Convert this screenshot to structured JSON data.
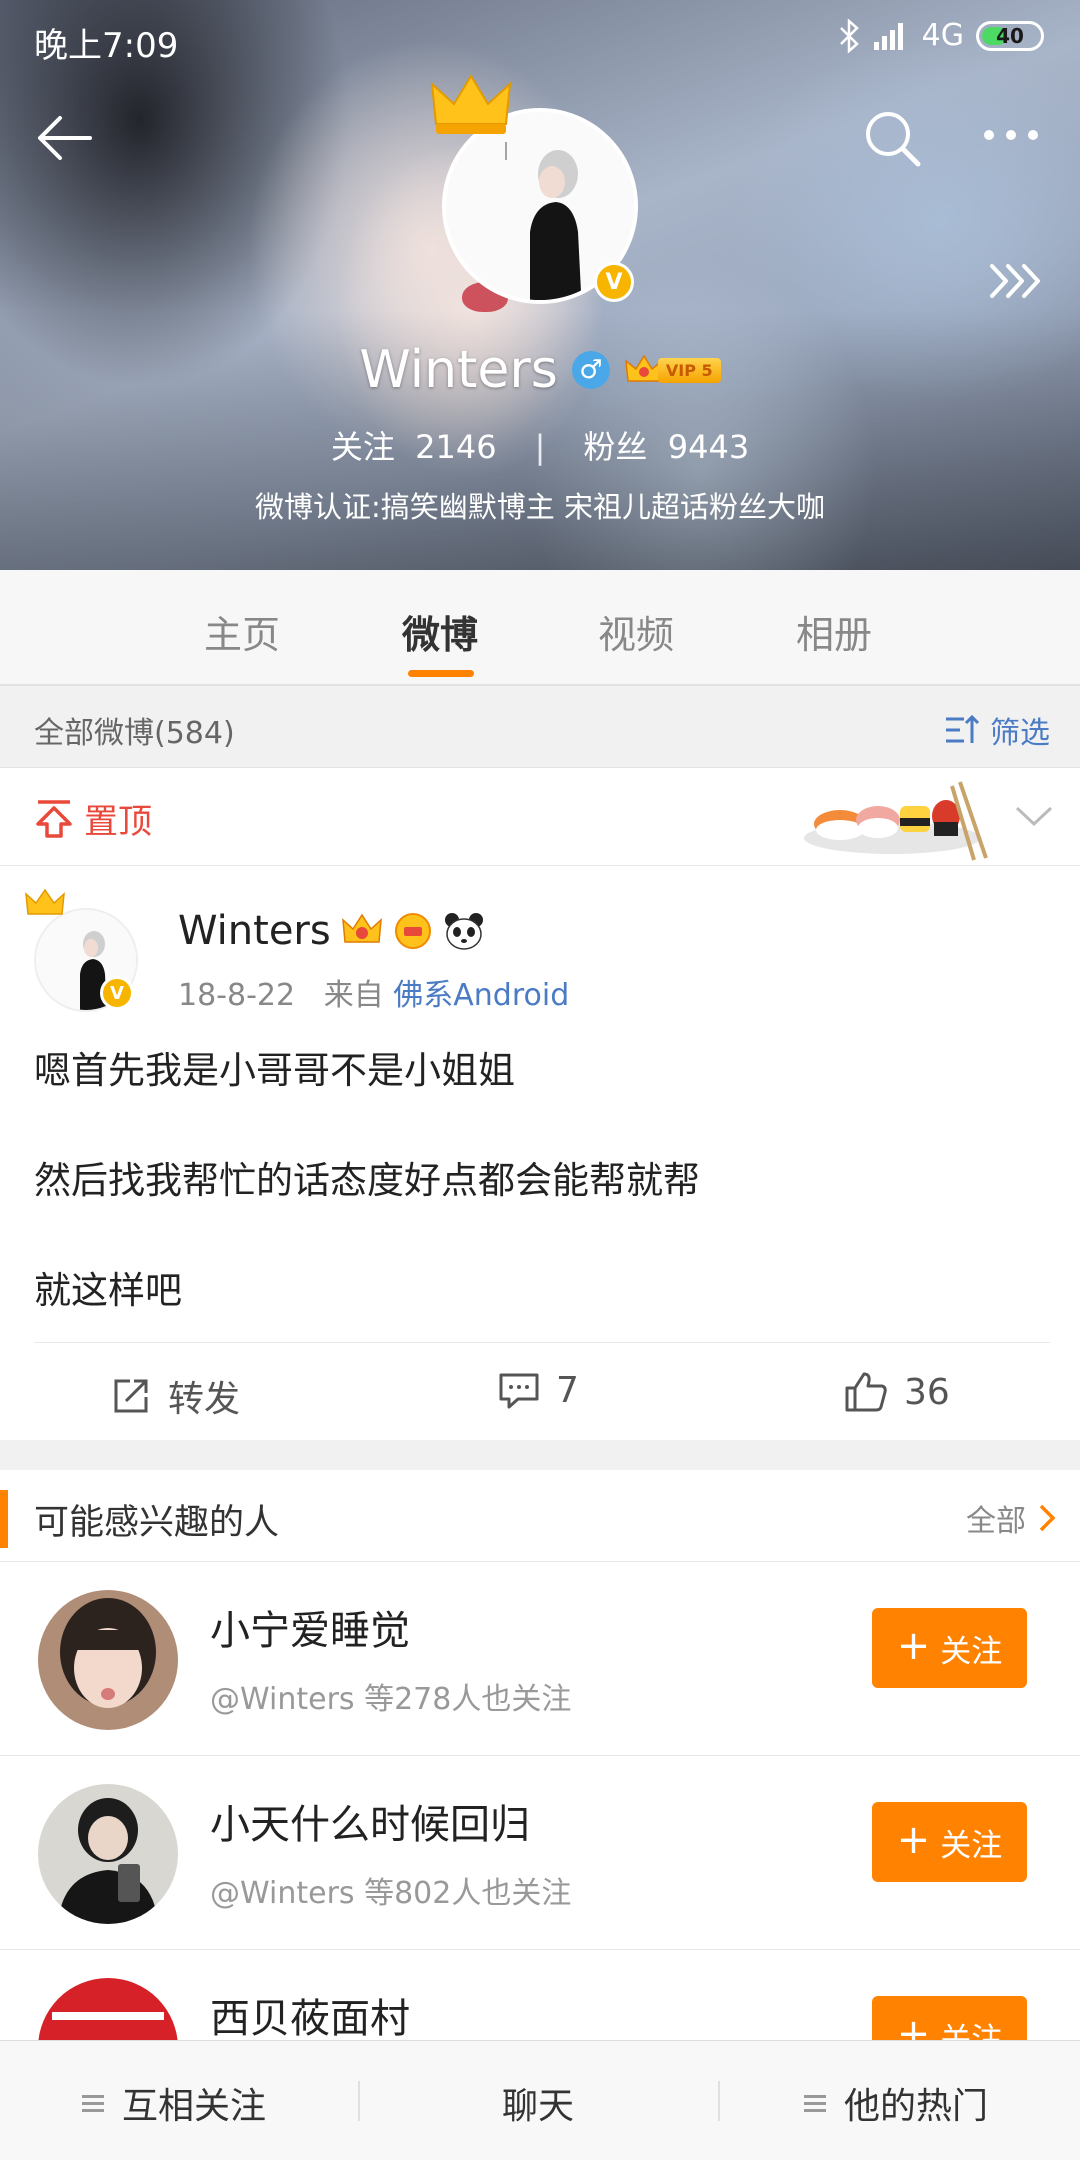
{
  "status_bar": {
    "time": "晚上7:09",
    "network": "4G",
    "battery": "40"
  },
  "profile": {
    "name": "Winters",
    "vip_level": "VIP 5",
    "follow_label": "关注",
    "follow_count": "2146",
    "fans_label": "粉丝",
    "fans_count": "9443",
    "certification": "微博认证:搞笑幽默博主 宋祖儿超话粉丝大咖"
  },
  "tabs": [
    {
      "label": "主页",
      "active": false
    },
    {
      "label": "微博",
      "active": true
    },
    {
      "label": "视频",
      "active": false
    },
    {
      "label": "相册",
      "active": false
    }
  ],
  "feed_header": {
    "all_count": "全部微博(584)",
    "filter_label": "筛选"
  },
  "pinned": {
    "label": "置顶"
  },
  "post": {
    "author": "Winters",
    "date": "18-8-22",
    "from_label": "来自",
    "source": "佛系Android",
    "lines": [
      "嗯首先我是小哥哥不是小姐姐",
      "然后找我帮忙的话态度好点都会能帮就帮",
      "就这样吧"
    ],
    "repost_label": "转发",
    "comment_count": "7",
    "like_count": "36"
  },
  "recommend": {
    "title": "可能感兴趣的人",
    "all_label": "全部",
    "follow_button": "关注",
    "people": [
      {
        "name": "小宁爱睡觉",
        "desc": "@Winters 等278人也关注"
      },
      {
        "name": "小天什么时候回归",
        "desc": "@Winters 等802人也关注"
      },
      {
        "name": "西贝莜面村",
        "desc": ""
      }
    ]
  },
  "bottom_bar": {
    "mutual": "互相关注",
    "chat": "聊天",
    "hot": "他的热门"
  },
  "colors": {
    "accent": "#ff8200",
    "link": "#4b7bc4",
    "pin_red": "#e8493a",
    "verified_gold": "#f7b500"
  }
}
